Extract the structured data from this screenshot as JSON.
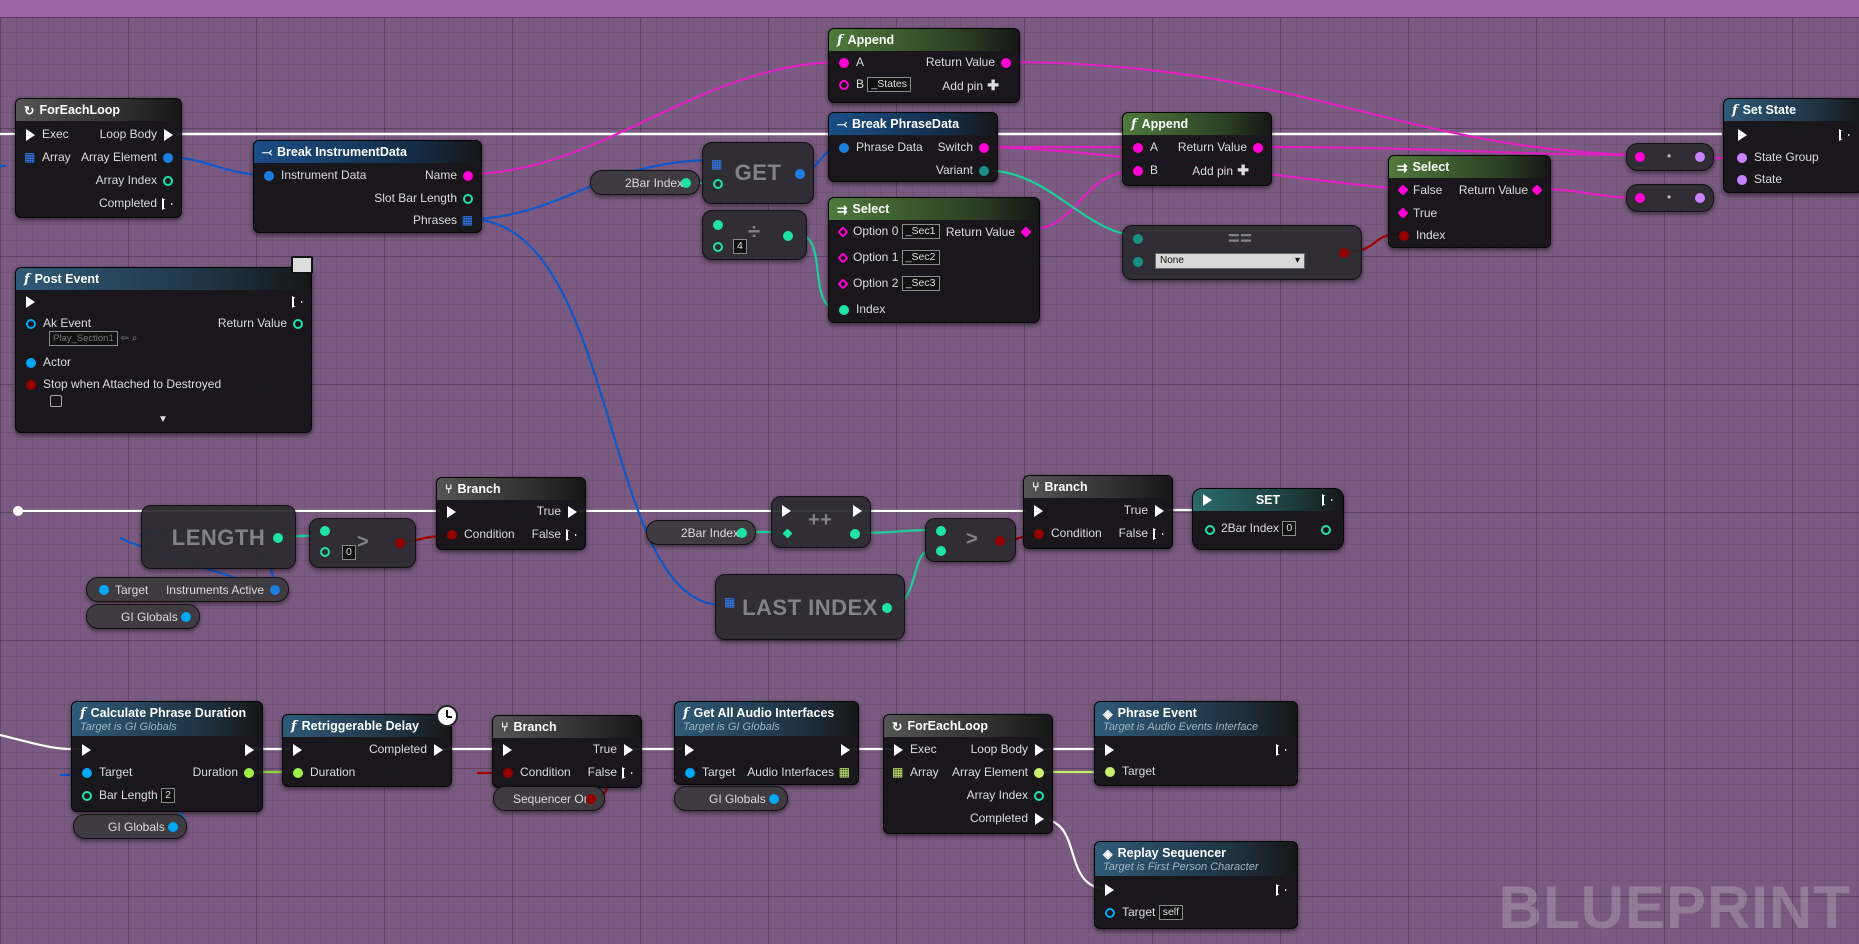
{
  "nodes": {
    "foreach1": {
      "title": "ForEachLoop",
      "exec": "Exec",
      "loop_body": "Loop Body",
      "array": "Array",
      "array_element": "Array Element",
      "array_index": "Array Index",
      "completed": "Completed"
    },
    "break_instrument": {
      "title": "Break InstrumentData",
      "in": "Instrument Data",
      "name": "Name",
      "slot": "Slot Bar Length",
      "phrases": "Phrases"
    },
    "append1": {
      "title": "Append",
      "a": "A",
      "b": "B",
      "b_value": "_States",
      "ret": "Return Value",
      "add_pin": "Add pin"
    },
    "break_phrase": {
      "title": "Break PhraseData",
      "in": "Phrase Data",
      "switch": "Switch",
      "variant": "Variant"
    },
    "append2": {
      "title": "Append",
      "a": "A",
      "b": "B",
      "ret": "Return Value",
      "add_pin": "Add pin"
    },
    "select1": {
      "title": "Select",
      "opt0": "Option 0",
      "opt0_val": "_Sec1",
      "opt1": "Option 1",
      "opt1_val": "_Sec2",
      "opt2": "Option 2",
      "opt2_val": "_Sec3",
      "index": "Index",
      "ret": "Return Value"
    },
    "select2": {
      "title": "Select",
      "false": "False",
      "true": "True",
      "index": "Index",
      "ret": "Return Value"
    },
    "set_state": {
      "title": "Set State",
      "group": "State Group",
      "state": "State"
    },
    "get": {
      "label": "GET"
    },
    "twobar1": {
      "label": "2Bar Index"
    },
    "divide": {
      "symbol": "÷",
      "value": "4"
    },
    "equals": {
      "symbol": "==",
      "dropdown": "None"
    },
    "post_event": {
      "title": "Post Event",
      "ak_event": "Ak Event",
      "ak_value": "Play_Section1",
      "ret": "Return Value",
      "actor": "Actor",
      "stop": "Stop when Attached to Destroyed"
    },
    "length": {
      "label": "LENGTH"
    },
    "greater1": {
      "symbol": ">",
      "value": "0"
    },
    "branch1": {
      "title": "Branch",
      "condition": "Condition",
      "true": "True",
      "false": "False"
    },
    "instruments_active": {
      "target": "Target",
      "label": "Instruments Active"
    },
    "gi_globals1": {
      "label": "GI Globals"
    },
    "twobar2": {
      "label": "2Bar Index"
    },
    "increment": {
      "symbol": "++"
    },
    "greater2": {
      "symbol": ">"
    },
    "last_index": {
      "label": "LAST INDEX"
    },
    "branch2": {
      "title": "Branch",
      "condition": "Condition",
      "true": "True",
      "false": "False"
    },
    "set_node": {
      "title": "SET",
      "label": "2Bar Index",
      "value": "0"
    },
    "calc_phrase": {
      "title": "Calculate Phrase Duration",
      "subtitle": "Target is GI Globals",
      "target": "Target",
      "duration": "Duration",
      "bar_length": "Bar Length",
      "bar_value": "2"
    },
    "gi_globals2": {
      "label": "GI Globals"
    },
    "retrig_delay": {
      "title": "Retriggerable Delay",
      "completed": "Completed",
      "duration": "Duration"
    },
    "branch3": {
      "title": "Branch",
      "condition": "Condition",
      "true": "True",
      "false": "False"
    },
    "sequencer_on": {
      "label": "Sequencer On"
    },
    "get_audio": {
      "title": "Get All Audio Interfaces",
      "subtitle": "Target is GI Globals",
      "target": "Target",
      "interfaces": "Audio Interfaces"
    },
    "gi_globals3": {
      "label": "GI Globals"
    },
    "foreach2": {
      "title": "ForEachLoop",
      "exec": "Exec",
      "loop_body": "Loop Body",
      "array": "Array",
      "array_element": "Array Element",
      "array_index": "Array Index",
      "completed": "Completed"
    },
    "phrase_event": {
      "title": "Phrase Event",
      "subtitle": "Target is Audio Events Interface",
      "target": "Target"
    },
    "replay_seq": {
      "title": "Replay Sequencer",
      "subtitle": "Target is First Person Character",
      "target": "Target",
      "target_value": "self"
    }
  },
  "watermark": "BLUEPRINT",
  "colors": {
    "exec": "#ffffff",
    "string": "#ff00d4",
    "struct": "#0a62d4",
    "int": "#1ee3a4",
    "bool": "#940000",
    "object": "#00a8f4",
    "float": "#9ef046",
    "name": "#c882ff",
    "background": "#7a5a80"
  }
}
